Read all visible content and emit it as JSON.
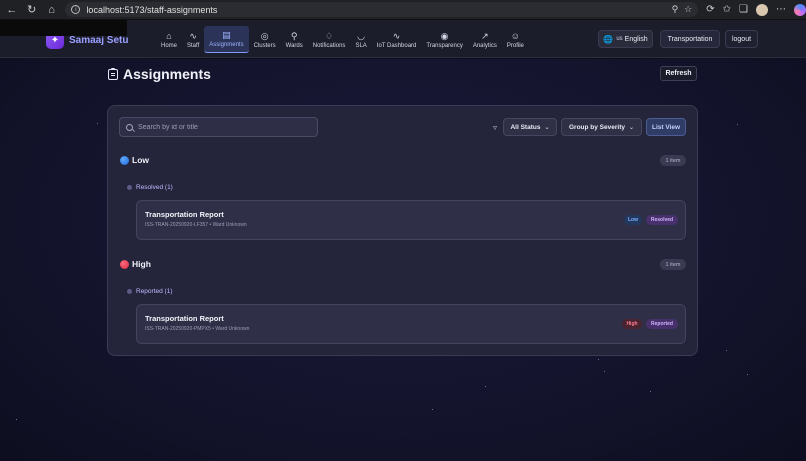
{
  "browser": {
    "url": "localhost:5173/staff-assignments"
  },
  "app": {
    "brand_name": "Samaaj Setu",
    "nav": [
      {
        "label": "Home",
        "icon": "home-icon"
      },
      {
        "label": "Staff",
        "icon": "activity-icon"
      },
      {
        "label": "Assignments",
        "icon": "clipboard-icon",
        "active": true
      },
      {
        "label": "Clusters",
        "icon": "target-icon"
      },
      {
        "label": "Wards",
        "icon": "map-pin-icon"
      },
      {
        "label": "Notifications",
        "icon": "bell-icon"
      },
      {
        "label": "SLA",
        "icon": "gauge-icon"
      },
      {
        "label": "IoT Dashboard",
        "icon": "activity-icon"
      },
      {
        "label": "Transparency",
        "icon": "eye-icon"
      },
      {
        "label": "Analytics",
        "icon": "trending-up-icon"
      },
      {
        "label": "Profile",
        "icon": "user-icon"
      }
    ],
    "language": {
      "flag": "us",
      "label": "English"
    },
    "department_button": "Transportation",
    "logout_button": "logout"
  },
  "page": {
    "title": "Assignments",
    "refresh_button": "Refresh",
    "search_placeholder": "Search by id or title",
    "status_filter": "All Status",
    "group_by": "Group by Severity",
    "view_button": "List View"
  },
  "groups": [
    {
      "severity": "Low",
      "count_label": "1 item",
      "status_group": "Resolved (1)",
      "items": [
        {
          "title": "Transportation Report",
          "subtitle": "ISS-TRAN-20250920-LF357 • Ward Unknown",
          "severity_tag": "Low",
          "status_tag": "Resolved"
        }
      ]
    },
    {
      "severity": "High",
      "count_label": "1 item",
      "status_group": "Reported (1)",
      "items": [
        {
          "title": "Transportation Report",
          "subtitle": "ISS-TRAN-20250920-PMPX5 • Ward Unknown",
          "severity_tag": "High",
          "status_tag": "Reported"
        }
      ]
    }
  ],
  "colors": {
    "accent": "#7f9cff",
    "severity_low": "#3b8cff",
    "severity_high": "#e5394f",
    "status_tag": "#cdb3ff"
  }
}
